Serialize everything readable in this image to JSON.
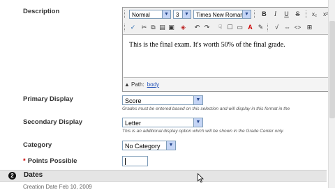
{
  "description": {
    "label": "Description",
    "editor": {
      "format": "Normal",
      "size": "3",
      "font": "Times New Roman",
      "buttons_row1": [
        "B",
        "I",
        "U",
        "S",
        "x₂",
        "x²"
      ],
      "content": "This is the final exam.  It's worth 50% of the final grade.",
      "path_label": "Path:",
      "path_value": "body"
    }
  },
  "primary_display": {
    "label": "Primary Display",
    "value": "Score",
    "hint": "Grades must be entered based on this selection and will display in this format in the"
  },
  "secondary_display": {
    "label": "Secondary Display",
    "value": "Letter",
    "hint": "This is an additional display option which will be shown in the Grade Center only."
  },
  "category": {
    "label": "Category",
    "value": "No Category"
  },
  "points": {
    "required_mark": "*",
    "label": "Points Possible",
    "value": ""
  },
  "dates_section": {
    "number": "2",
    "title": "Dates"
  },
  "cutoff_text": "Creation Date   Feb 10, 2009",
  "colors": {
    "link": "#1f4fb7",
    "required": "#cc0000",
    "section_bg": "#e5e5e5"
  }
}
